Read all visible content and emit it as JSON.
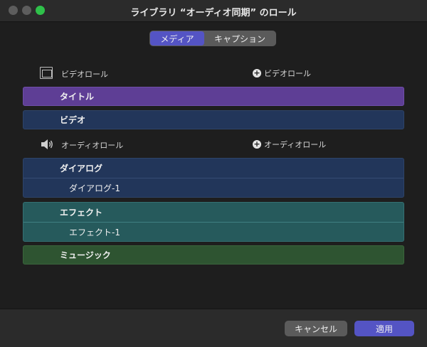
{
  "window": {
    "title": "ライブラリ “オーディオ同期” のロール",
    "colors": {
      "accent": "#5454c4",
      "purple_role": "#5e3e95",
      "navy_role": "#22365a",
      "teal_role": "#265a5c",
      "green_role": "#2e5431"
    }
  },
  "tabs": [
    {
      "label": "メディア",
      "selected": true
    },
    {
      "label": "キャプション",
      "selected": false
    }
  ],
  "video": {
    "header": "ビデオロール",
    "icon": "film-icon",
    "add_label": "ビデオロール",
    "roles": [
      "タイトル",
      "ビデオ"
    ]
  },
  "audio": {
    "header": "オーディオロール",
    "icon": "speaker-icon",
    "add_label": "オーディオロール",
    "dialogue": {
      "label": "ダイアログ",
      "sub": "ダイアログ-1"
    },
    "effects": {
      "label": "エフェクト",
      "sub": "エフェクト-1"
    },
    "music": {
      "label": "ミュージック"
    }
  },
  "footer": {
    "cancel_label": "キャンセル",
    "apply_label": "適用"
  }
}
